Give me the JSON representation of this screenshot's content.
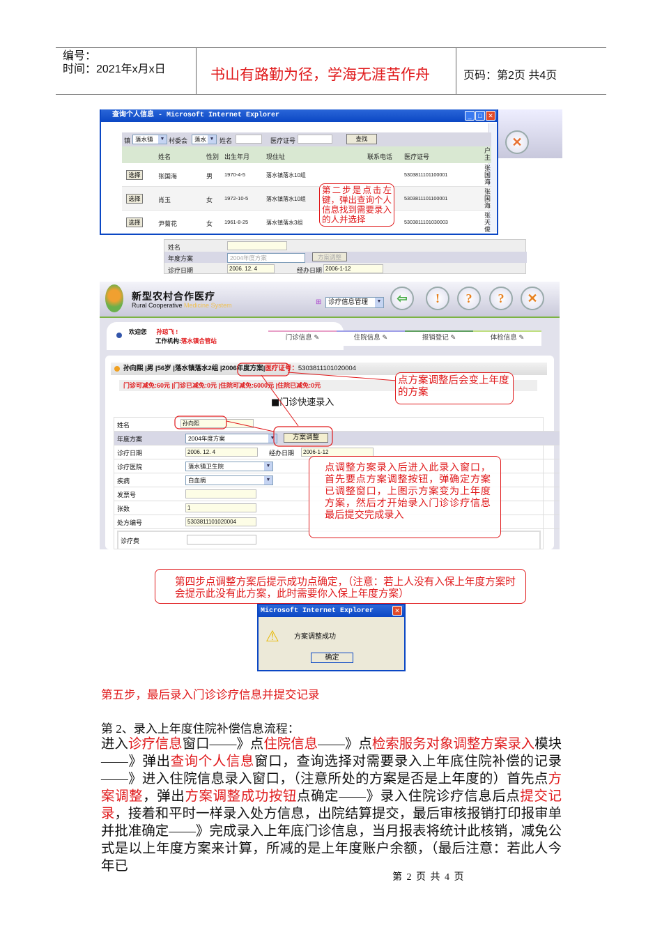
{
  "header": {
    "number_label": "编号：",
    "time_label": "时间：2021年x月x日",
    "motto": "书山有路勤为径，学海无涯苦作舟",
    "page_label": "页码：第2页 共4页"
  },
  "shot1": {
    "title": "查询个人信息 - Microsoft Internet Explorer",
    "filters": {
      "town_label": "镇",
      "town_value": "落水镇",
      "village_label": "村委会",
      "village_value": "落水",
      "name_label": "姓名",
      "card_label": "医疗证号",
      "search_button": "查找"
    },
    "columns": [
      "姓名",
      "性别",
      "出生年月",
      "现住址",
      "联系电话",
      "医疗证号",
      "户主"
    ],
    "rows": [
      {
        "select": "选择",
        "name": "张国海",
        "sex": "男",
        "birth": "1970-4-5",
        "address": "落水镇落水10组",
        "phone": "",
        "card": "5303811101100001",
        "head": "张国海"
      },
      {
        "select": "选择",
        "name": "肖玉",
        "sex": "女",
        "birth": "1972-10-5",
        "address": "落水镇落水10组",
        "phone": "",
        "card": "5303811101100001",
        "head": "张国海"
      },
      {
        "select": "选择",
        "name": "尹菊花",
        "sex": "女",
        "birth": "1961-8-25",
        "address": "落水镇落水3组",
        "phone": "",
        "card": "5303811101030003",
        "head": "张天俊"
      }
    ],
    "callout": "第二步是点击左键，弹出查询个人信息找到需要录入的人并选择",
    "bg_form": {
      "name_label": "姓名",
      "plan_label": "年度方案",
      "plan_value": "2004年度方案",
      "adjust_button": "方案调整",
      "date_label": "诊疗日期",
      "date_value": "2006. 12. 4",
      "handle_label": "经办日期",
      "handle_value": "2006-1-12"
    }
  },
  "shot2": {
    "logo_title": "新型农村合作医疗",
    "logo_sub_a": "Rural Cooperative ",
    "logo_sub_b": "Medicine System",
    "module_select": "诊疗信息管理",
    "welcome": "欢迎您",
    "user": "孙琼飞 !",
    "org_label": "工作机构:",
    "org": "落水镇合管站",
    "tabs": [
      "门诊信息",
      "住院信息",
      "报销登记",
      "体检信息"
    ],
    "patient": {
      "info": "孙向熙 |男 |56岁 |落水镇落水2组 |",
      "plan": "2006年度方案",
      "sep": "|",
      "card_label": "医疗证号：",
      "card": "5303811101020004"
    },
    "quota": "门诊可减免:60元 |门诊已减免:0元 |住院可减免:6000元 |住院已减免:0元",
    "section_title": "门诊快速录入",
    "form": {
      "name_label": "姓名",
      "name_value": "孙向熙",
      "plan_label": "年度方案",
      "plan_value": "2004年度方案",
      "adjust_button": "方案调整",
      "date_label": "诊疗日期",
      "date_value": "2006. 12. 4",
      "handle_label": "经办日期",
      "handle_value": "2006-1-12",
      "hospital_label": "诊疗医院",
      "hospital_value": "落水镇卫生院",
      "disease_label": "疾病",
      "disease_value": "白血病",
      "invoice_label": "发票号",
      "invoice_value": "",
      "count_label": "张数",
      "count_value": "1",
      "rx_label": "处方编号",
      "rx_value": "5303811101020004",
      "fee_label": "诊疗费",
      "fee_value": ""
    },
    "callout_plan": "点方案调整后会变上年度的方案",
    "callout_steps": "点调整方案录入后进入此录入窗口，首先要点方案调整按钮，弹确定方案已调整窗口，上图示方案变为上年度方案，然后才开始录入门诊诊疗信息最后提交完成录入"
  },
  "step4": "第四步点调整方案后提示成功点确定，（注意：若上人没有入保上年度方案时会提示此没有此方案，此时需要你入保上年度方案）",
  "dialog": {
    "title": "Microsoft Internet Explorer",
    "message": "方案调整成功",
    "ok": "确定"
  },
  "step5": "第五步，最后录入门诊诊疗信息并提交记录",
  "section2_title": "第 2、录入上年度住院补偿信息流程：",
  "section2_body": [
    {
      "t": "进入",
      "red": false
    },
    {
      "t": "诊疗信息",
      "red": true
    },
    {
      "t": "窗口——》点",
      "red": false
    },
    {
      "t": "住院信息",
      "red": true
    },
    {
      "t": "——》点",
      "red": false
    },
    {
      "t": "检索服务对象调整方案录入",
      "red": true
    },
    {
      "t": "模块——》弹出",
      "red": false
    },
    {
      "t": "查询个人信息",
      "red": true
    },
    {
      "t": "窗口，查询选择对需要录入上年底住院补偿的记录——》进入住院信息录入窗口，（注意所处的方案是否是上年度的）首先点",
      "red": false
    },
    {
      "t": "方案调整",
      "red": true
    },
    {
      "t": "，弹出",
      "red": false
    },
    {
      "t": "方案调整成功按钮",
      "red": true
    },
    {
      "t": "点确定——》录入住院诊疗信息后点",
      "red": false
    },
    {
      "t": "提交记录",
      "red": true
    },
    {
      "t": "，接着和平时一样录入处方信息，出院结算提交，最后审核报销打印报审单并批准确定——》完成录入上年底门诊信息，当月报表将统计此核销，减免公式是以上年度方案来计算，所减的是上年度账户余额，（最后注意：若此人今年已",
      "red": false
    }
  ],
  "footer": "第 2 页 共 4 页"
}
